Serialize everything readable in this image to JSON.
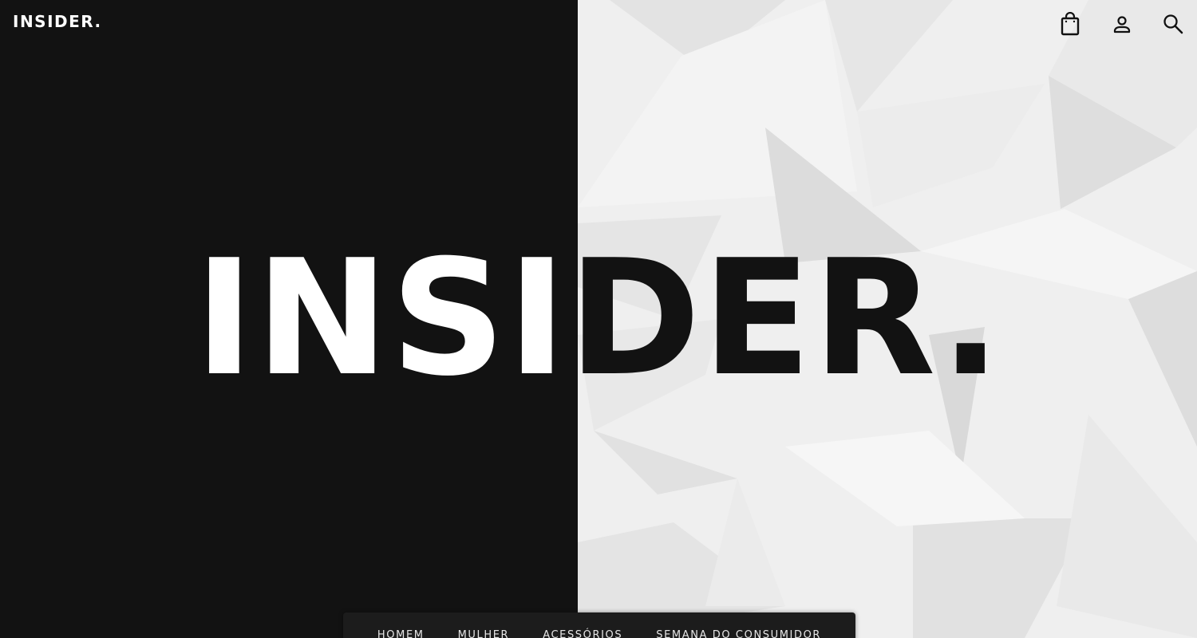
{
  "header": {
    "logo": "INSIDER.",
    "icons": [
      "shopping-bag-icon",
      "user-icon",
      "search-icon"
    ]
  },
  "hero": {
    "title": "INSIDER."
  },
  "nav": {
    "items": [
      {
        "label": "HOMEM"
      },
      {
        "label": "MULHER"
      },
      {
        "label": "ACESSÓRIOS"
      },
      {
        "label": "SEMANA DO CONSUMIDOR"
      }
    ]
  },
  "colors": {
    "dark": "#121212",
    "light": "#efefef",
    "nav_bg": "#1c1c1c",
    "text_light": "#ffffff"
  }
}
